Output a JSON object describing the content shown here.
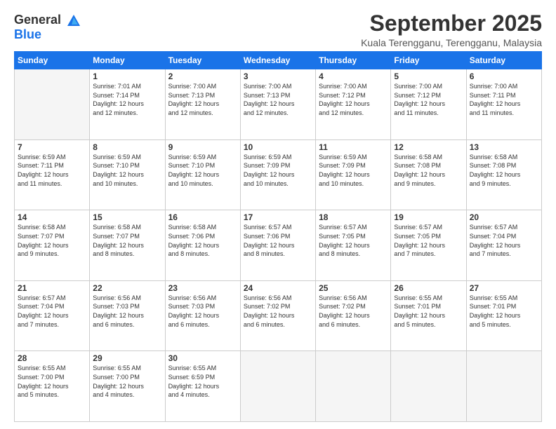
{
  "logo": {
    "line1": "General",
    "line2": "Blue"
  },
  "title": "September 2025",
  "subtitle": "Kuala Terengganu, Terengganu, Malaysia",
  "days_of_week": [
    "Sunday",
    "Monday",
    "Tuesday",
    "Wednesday",
    "Thursday",
    "Friday",
    "Saturday"
  ],
  "weeks": [
    [
      {
        "day": "",
        "info": ""
      },
      {
        "day": "1",
        "info": "Sunrise: 7:01 AM\nSunset: 7:14 PM\nDaylight: 12 hours\nand 12 minutes."
      },
      {
        "day": "2",
        "info": "Sunrise: 7:00 AM\nSunset: 7:13 PM\nDaylight: 12 hours\nand 12 minutes."
      },
      {
        "day": "3",
        "info": "Sunrise: 7:00 AM\nSunset: 7:13 PM\nDaylight: 12 hours\nand 12 minutes."
      },
      {
        "day": "4",
        "info": "Sunrise: 7:00 AM\nSunset: 7:12 PM\nDaylight: 12 hours\nand 12 minutes."
      },
      {
        "day": "5",
        "info": "Sunrise: 7:00 AM\nSunset: 7:12 PM\nDaylight: 12 hours\nand 11 minutes."
      },
      {
        "day": "6",
        "info": "Sunrise: 7:00 AM\nSunset: 7:11 PM\nDaylight: 12 hours\nand 11 minutes."
      }
    ],
    [
      {
        "day": "7",
        "info": "Sunrise: 6:59 AM\nSunset: 7:11 PM\nDaylight: 12 hours\nand 11 minutes."
      },
      {
        "day": "8",
        "info": "Sunrise: 6:59 AM\nSunset: 7:10 PM\nDaylight: 12 hours\nand 10 minutes."
      },
      {
        "day": "9",
        "info": "Sunrise: 6:59 AM\nSunset: 7:10 PM\nDaylight: 12 hours\nand 10 minutes."
      },
      {
        "day": "10",
        "info": "Sunrise: 6:59 AM\nSunset: 7:09 PM\nDaylight: 12 hours\nand 10 minutes."
      },
      {
        "day": "11",
        "info": "Sunrise: 6:59 AM\nSunset: 7:09 PM\nDaylight: 12 hours\nand 10 minutes."
      },
      {
        "day": "12",
        "info": "Sunrise: 6:58 AM\nSunset: 7:08 PM\nDaylight: 12 hours\nand 9 minutes."
      },
      {
        "day": "13",
        "info": "Sunrise: 6:58 AM\nSunset: 7:08 PM\nDaylight: 12 hours\nand 9 minutes."
      }
    ],
    [
      {
        "day": "14",
        "info": "Sunrise: 6:58 AM\nSunset: 7:07 PM\nDaylight: 12 hours\nand 9 minutes."
      },
      {
        "day": "15",
        "info": "Sunrise: 6:58 AM\nSunset: 7:07 PM\nDaylight: 12 hours\nand 8 minutes."
      },
      {
        "day": "16",
        "info": "Sunrise: 6:58 AM\nSunset: 7:06 PM\nDaylight: 12 hours\nand 8 minutes."
      },
      {
        "day": "17",
        "info": "Sunrise: 6:57 AM\nSunset: 7:06 PM\nDaylight: 12 hours\nand 8 minutes."
      },
      {
        "day": "18",
        "info": "Sunrise: 6:57 AM\nSunset: 7:05 PM\nDaylight: 12 hours\nand 8 minutes."
      },
      {
        "day": "19",
        "info": "Sunrise: 6:57 AM\nSunset: 7:05 PM\nDaylight: 12 hours\nand 7 minutes."
      },
      {
        "day": "20",
        "info": "Sunrise: 6:57 AM\nSunset: 7:04 PM\nDaylight: 12 hours\nand 7 minutes."
      }
    ],
    [
      {
        "day": "21",
        "info": "Sunrise: 6:57 AM\nSunset: 7:04 PM\nDaylight: 12 hours\nand 7 minutes."
      },
      {
        "day": "22",
        "info": "Sunrise: 6:56 AM\nSunset: 7:03 PM\nDaylight: 12 hours\nand 6 minutes."
      },
      {
        "day": "23",
        "info": "Sunrise: 6:56 AM\nSunset: 7:03 PM\nDaylight: 12 hours\nand 6 minutes."
      },
      {
        "day": "24",
        "info": "Sunrise: 6:56 AM\nSunset: 7:02 PM\nDaylight: 12 hours\nand 6 minutes."
      },
      {
        "day": "25",
        "info": "Sunrise: 6:56 AM\nSunset: 7:02 PM\nDaylight: 12 hours\nand 6 minutes."
      },
      {
        "day": "26",
        "info": "Sunrise: 6:55 AM\nSunset: 7:01 PM\nDaylight: 12 hours\nand 5 minutes."
      },
      {
        "day": "27",
        "info": "Sunrise: 6:55 AM\nSunset: 7:01 PM\nDaylight: 12 hours\nand 5 minutes."
      }
    ],
    [
      {
        "day": "28",
        "info": "Sunrise: 6:55 AM\nSunset: 7:00 PM\nDaylight: 12 hours\nand 5 minutes."
      },
      {
        "day": "29",
        "info": "Sunrise: 6:55 AM\nSunset: 7:00 PM\nDaylight: 12 hours\nand 4 minutes."
      },
      {
        "day": "30",
        "info": "Sunrise: 6:55 AM\nSunset: 6:59 PM\nDaylight: 12 hours\nand 4 minutes."
      },
      {
        "day": "",
        "info": ""
      },
      {
        "day": "",
        "info": ""
      },
      {
        "day": "",
        "info": ""
      },
      {
        "day": "",
        "info": ""
      }
    ]
  ]
}
